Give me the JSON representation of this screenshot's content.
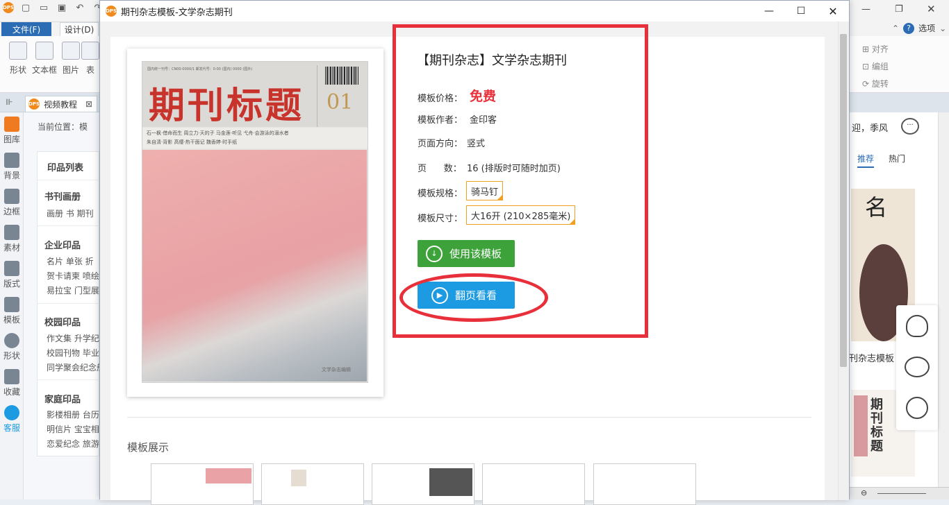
{
  "window_title": "期刊杂志模板-文学杂志期刊",
  "app_badge": "DPS",
  "ribbon": {
    "file_tab": "文件(F)",
    "design_tab": "设计(D)",
    "buttons": [
      "形状",
      "文本框",
      "图片",
      "表"
    ],
    "right_items": [
      "对齐",
      "编组",
      "旋转"
    ],
    "options": "选项"
  },
  "doc_tab": "视频教程",
  "sidebar": [
    "图库",
    "背景",
    "边框",
    "素材",
    "版式",
    "模板",
    "形状",
    "收藏",
    "客服"
  ],
  "breadcrumb": "当前位置：模",
  "catalog": {
    "title": "印品列表",
    "sections": [
      {
        "title": "书刊画册",
        "items": [
          "画册  书  期刊"
        ]
      },
      {
        "title": "企业印品",
        "items": [
          "名片  单张  折",
          "贺卡请柬  喷绘",
          "易拉宝  门型展"
        ]
      },
      {
        "title": "校园印品",
        "items": [
          "作文集  升学纪",
          "校园刊物  毕业",
          "同学聚会纪念册"
        ]
      },
      {
        "title": "家庭印品",
        "items": [
          "影楼相册  台历",
          "明信片  宝宝相",
          "恋爱纪念  旅游"
        ]
      }
    ]
  },
  "right_panel": {
    "greeting": "迎，季风",
    "tabs": [
      "推荐",
      "热门"
    ],
    "caption": "刊杂志模板"
  },
  "cover": {
    "title": "期刊标题",
    "issue": "01",
    "top_line": "国内统一刊号：CN00-0000/1  邮发代号：0-00 (国内) 0000 (国外)",
    "lines": [
      "石一枫·借命而生  周立力·天的子  马金莲·听见  弋舟·会游泳的溺水者",
      "朱自清·背影  高缨·热干面记  魏香婷·时手纸"
    ],
    "foot": "文学杂志编辑"
  },
  "info": {
    "title": "【期刊杂志】文学杂志期刊",
    "price_label": "模板价格：",
    "price": "免费",
    "author_label": "模板作者：",
    "author": "金印客",
    "orientation_label": "页面方向：",
    "orientation": "竖式",
    "pages_label": "页      数：",
    "pages": "16 (排版时可随时加页)",
    "spec_label": "模板规格：",
    "spec": "骑马钉",
    "size_label": "模板尺寸：",
    "size": "大16开 (210×285毫米)",
    "use_button": "使用该模板",
    "flip_button": "翻页看看"
  },
  "showcase_label": "模板展示",
  "colors": {
    "accent_red": "#e8303a",
    "green": "#3ea23a",
    "blue": "#1c9ae2",
    "file_tab": "#2b6cb5"
  }
}
